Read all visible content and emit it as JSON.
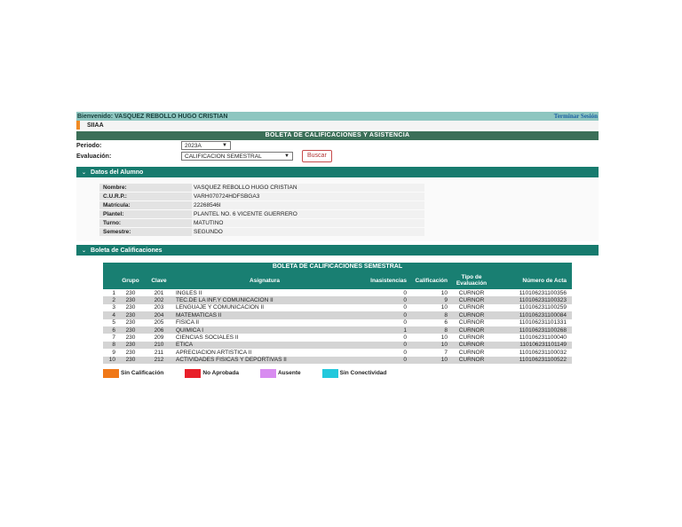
{
  "header": {
    "welcome": "Bienvenido: VASQUEZ REBOLLO HUGO CRISTIAN",
    "logout": "Terminar Sesión"
  },
  "nav": {
    "system": "SIIAA"
  },
  "banner": {
    "title": "BOLETA DE CALIFICACIONES Y ASISTENCIA"
  },
  "form": {
    "periodo_label": "Periodo:",
    "periodo_value": "2023A",
    "evaluacion_label": "Evaluación:",
    "evaluacion_value": "CALIFICACION SEMESTRAL",
    "search_label": "Buscar"
  },
  "student_section": {
    "title": "Datos del Alumno",
    "fields": [
      {
        "label": "Nombre:",
        "value": "VASQUEZ REBOLLO HUGO CRISTIAN"
      },
      {
        "label": "C.U.R.P.:",
        "value": "VARH070724HDFSBGA3"
      },
      {
        "label": "Matrícula:",
        "value": "22268546I"
      },
      {
        "label": "Plantel:",
        "value": "PLANTEL NO. 6 VICENTE GUERRERO"
      },
      {
        "label": "Turno:",
        "value": "MATUTINO"
      },
      {
        "label": "Semestre:",
        "value": "SEGUNDO"
      }
    ]
  },
  "grades_section": {
    "title": "Boleta de Calificaciones",
    "table_title": "BOLETA DE CALIFICACIONES SEMESTRAL",
    "headers": [
      "",
      "Grupo",
      "Clave",
      "Asignatura",
      "Inasistencias",
      "Calificación",
      "Tipo de Evaluación",
      "Número de Acta"
    ],
    "rows": [
      [
        "1",
        "230",
        "201",
        "INGLES II",
        "0",
        "10",
        "CURNOR",
        "110106231100356"
      ],
      [
        "2",
        "230",
        "202",
        "TEC.DE LA INF.Y COMUNICACION II",
        "0",
        "9",
        "CURNOR",
        "110106231100323"
      ],
      [
        "3",
        "230",
        "203",
        "LENGUAJE Y COMUNICACION II",
        "0",
        "10",
        "CURNOR",
        "110106231100259"
      ],
      [
        "4",
        "230",
        "204",
        "MATEMATICAS II",
        "0",
        "8",
        "CURNOR",
        "110106231100084"
      ],
      [
        "5",
        "230",
        "205",
        "FISICA II",
        "0",
        "6",
        "CURNOR",
        "110106231101331"
      ],
      [
        "6",
        "230",
        "206",
        "QUIMICA I",
        "1",
        "8",
        "CURNOR",
        "110106231100268"
      ],
      [
        "7",
        "230",
        "209",
        "CIENCIAS SOCIALES II",
        "0",
        "10",
        "CURNOR",
        "110106231100040"
      ],
      [
        "8",
        "230",
        "210",
        "ETICA",
        "0",
        "10",
        "CURNOR",
        "110106231101149"
      ],
      [
        "9",
        "230",
        "211",
        "APRECIACION ARTISTICA II",
        "0",
        "7",
        "CURNOR",
        "110106231100032"
      ],
      [
        "10",
        "230",
        "212",
        "ACTIVIDADES FISICAS Y DEPORTIVAS II",
        "0",
        "10",
        "CURNOR",
        "110106231100522"
      ]
    ]
  },
  "legend": [
    {
      "label": "Sin Calificación",
      "color": "#f07818"
    },
    {
      "label": "No Aprobada",
      "color": "#e8202a"
    },
    {
      "label": "Ausente",
      "color": "#d88cf0"
    },
    {
      "label": "Sin Conectividad",
      "color": "#22c8dc"
    }
  ]
}
